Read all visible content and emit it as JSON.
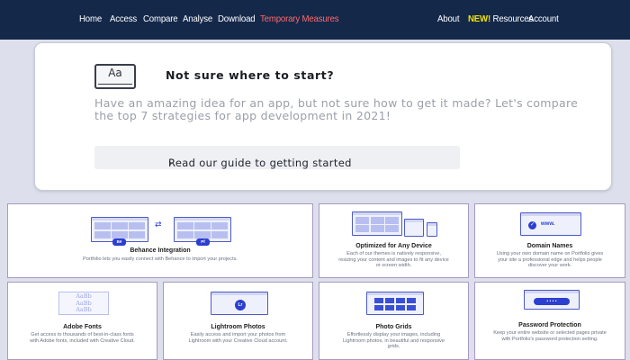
{
  "nav": {
    "home": "Home",
    "access": "Access",
    "compare": "Compare",
    "analyse": "Analyse",
    "download": "Download",
    "temporary_measures": "Temporary Measures",
    "about": "About",
    "new_badge": "NEW!",
    "resources": "Resources",
    "account": "Account"
  },
  "guide_card": {
    "icon_text": "Aa",
    "title": "Not sure where to start?",
    "body": "Have an amazing idea for an app, but not sure how to get it made? Let's compare the top 7 strategies for app development in 2021!",
    "button_label": "Read our guide to getting started",
    "button_arrow": "›"
  },
  "features": {
    "behance": {
      "title": "Behance Integration",
      "desc": "Portfolio lets you easily connect with Behance to import your projects.",
      "badge_left": "Bē",
      "badge_right": "Pf"
    },
    "device": {
      "title": "Optimized for Any Device",
      "desc": "Each of our themes is natively responsive, resizing your content and images to fit any device or screen width."
    },
    "domain": {
      "title": "Domain Names",
      "desc": "Using your own domain name on Portfolio gives your site a professional edge and helps people discover your work.",
      "url_text": "www."
    },
    "fonts": {
      "title": "Adobe Fonts",
      "desc": "Get access to thousands of best-in-class fonts with Adobe fonts, included with Creative Cloud.",
      "sample": "AaBb"
    },
    "lightroom": {
      "title": "Lightroom Photos",
      "desc": "Easily access and import your photos from Lightroom with your Creative Cloud account.",
      "logo": "Lr"
    },
    "grids": {
      "title": "Photo Grids",
      "desc": "Effortlessly display your images, including Lightroom photos, in beautiful and responsive grids."
    },
    "password": {
      "title": "Password Protection",
      "desc": "Keep your entire website or selected pages private with Portfolio's password protection setting.",
      "field_dots": "• • • •"
    }
  },
  "colors": {
    "nav_bg": "#14284a",
    "accent_red": "#ff6a6a",
    "new_yellow": "#f2e300",
    "illustration_blue": "#2c3fd0",
    "card_border": "#a799c2"
  }
}
